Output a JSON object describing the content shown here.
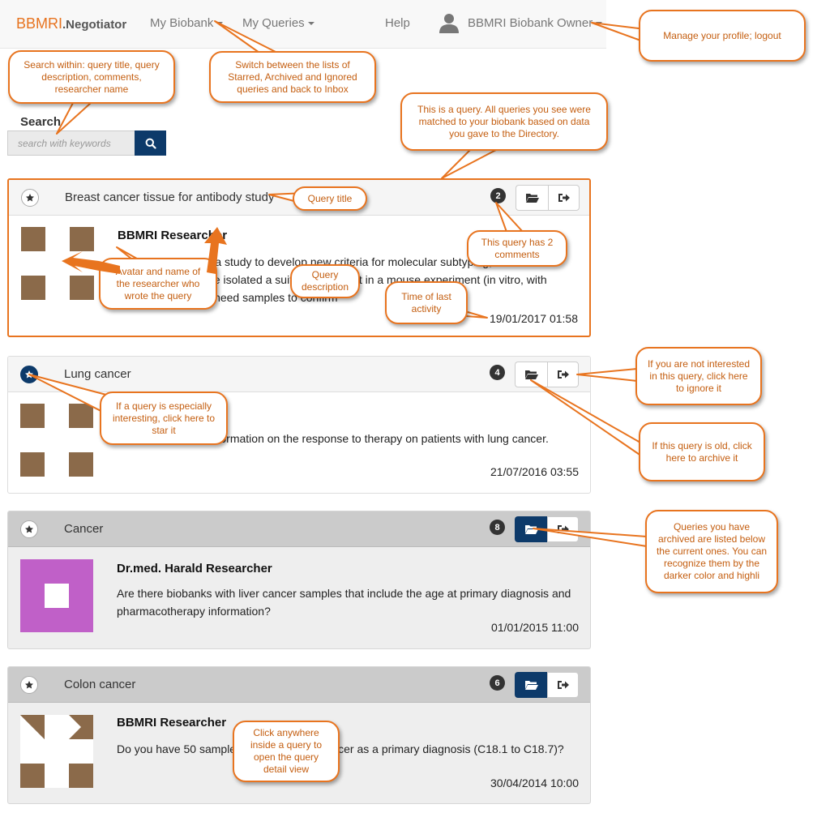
{
  "navbar": {
    "brand_main": "BBMRI",
    "brand_sub": ".Negotiator",
    "my_biobank": "My Biobank",
    "my_queries": "My Queries",
    "help": "Help",
    "user_name": "BBMRI Biobank Owner"
  },
  "search": {
    "label": "Search",
    "placeholder": "search with keywords",
    "button_icon": "search-icon"
  },
  "queries": [
    {
      "title": "Breast cancer tissue for antibody study",
      "comments": "2",
      "researcher": "BBMRI Researcher",
      "description": "We are conducting a study to develop new criteria for molecular subtyping, based on antibodies. We have isolated a suitable fragment in a mouse experiment (in vitro, with human tissue) and need samples to confirm",
      "time": "19/01/2017 01:58",
      "starred": false,
      "archived": false
    },
    {
      "title": "Lung cancer",
      "comments": "4",
      "researcher": "",
      "description": "We need detailed information on the response to therapy on patients with lung cancer.",
      "time": "21/07/2016 03:55",
      "starred": true,
      "archived": false
    },
    {
      "title": "Cancer",
      "comments": "8",
      "researcher": "Dr.med. Harald Researcher",
      "description": "Are there biobanks with liver cancer samples that include the age at primary diagnosis and pharmacotherapy information?",
      "time": "01/01/2015 11:00",
      "starred": false,
      "archived": true
    },
    {
      "title": "Colon cancer",
      "comments": "6",
      "researcher": "BBMRI Researcher",
      "description": "Do you have 50 samples with colorectal cancer as a primary diagnosis (C18.1 to C18.7)?",
      "time": "30/04/2014 10:00",
      "starred": false,
      "archived": true
    }
  ],
  "callouts": {
    "profile": "Manage your profile; logout",
    "lists": "Switch between the lists of Starred, Archived and Ignored queries and back to Inbox",
    "search": "Search within: query title, query description, comments, researcher name",
    "query": "This is a query. All queries you see were matched to your biobank based on data you gave to the Directory.",
    "title": "Query title",
    "comments": "This query has 2 comments",
    "avatar": "Avatar and name of the researcher who wrote the query",
    "description": "Query description",
    "time": "Time of last activity",
    "star": "If a query is especially interesting, click here to star it",
    "ignore": "If you are not interested in this query, click here to ignore it",
    "archive": "If this query is old, click here to archive it",
    "archived_list": "Queries you have archived are listed below the current ones. You can recognize them by the darker color and highli",
    "open": "Click anywhere inside a query to open the query detail view"
  },
  "colors": {
    "brand_orange": "#e7731f",
    "primary_blue": "#0d3a6a",
    "callout_border": "#e8741f",
    "callout_text": "#c45e10",
    "avatar_brown": "#8b6a4a",
    "avatar_magenta": "#c060c8"
  }
}
